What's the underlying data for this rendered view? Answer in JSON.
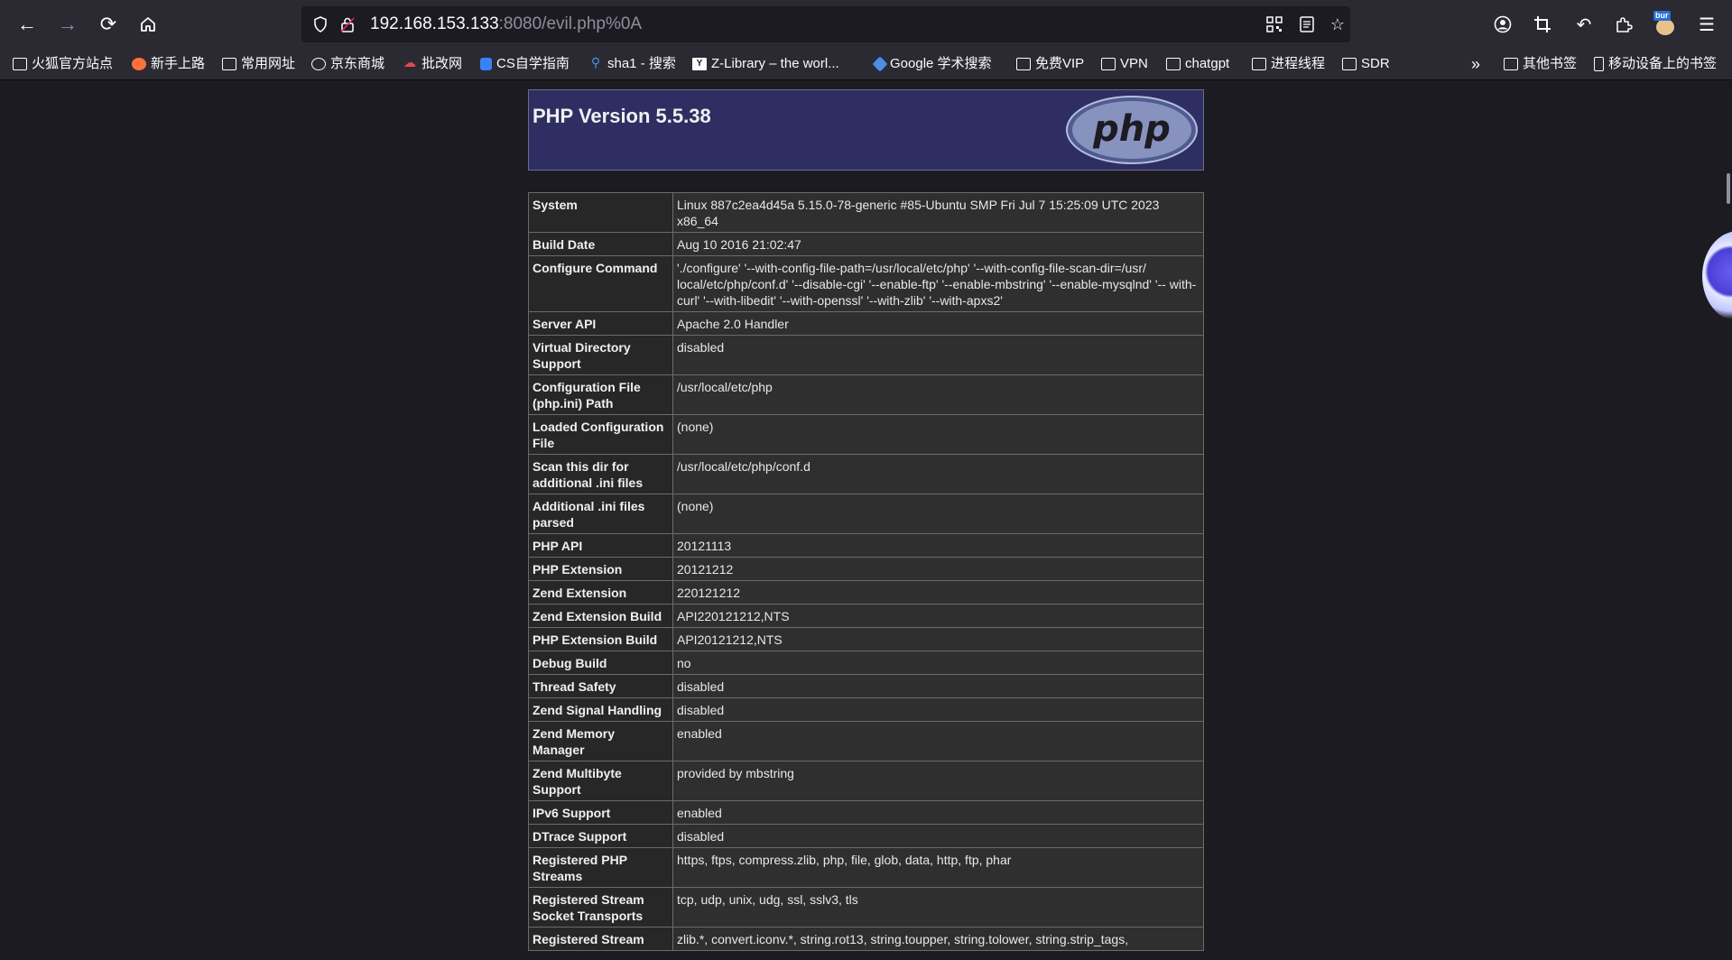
{
  "browser": {
    "url_host": "192.168.153.133",
    "url_path": ":8080/evil.php%0A",
    "profile_badge": "bur",
    "colors": {
      "chrome": "#2b2a33",
      "page": "#1c1b22",
      "header_bg": "#2e2e63"
    },
    "nav_icons": [
      "back-icon",
      "forward-icon",
      "reload-icon",
      "home-icon"
    ],
    "bookmarks": [
      {
        "label": "火狐官方站点",
        "icon": "folder-icon"
      },
      {
        "label": "新手上路",
        "icon": "firefox-icon"
      },
      {
        "label": "常用网址",
        "icon": "folder-icon"
      },
      {
        "label": "京东商城",
        "icon": "globe-icon"
      },
      {
        "label": "批改网",
        "icon": "cloud-icon"
      },
      {
        "label": "CS自学指南",
        "icon": "cube-icon"
      },
      {
        "label": "sha1 - 搜索",
        "icon": "search-icon"
      },
      {
        "label": "Z-Library – the worl...",
        "icon": "zlib-icon"
      },
      {
        "label": "Google 学术搜索",
        "icon": "scholar-icon"
      },
      {
        "label": "免费VIP",
        "icon": "folder-icon"
      },
      {
        "label": "VPN",
        "icon": "folder-icon"
      },
      {
        "label": "chatgpt",
        "icon": "folder-icon"
      },
      {
        "label": "进程线程",
        "icon": "folder-icon"
      },
      {
        "label": "SDR",
        "icon": "folder-icon"
      }
    ],
    "bookmarks_right": [
      {
        "label": "其他书签",
        "icon": "folder-icon"
      },
      {
        "label": "移动设备上的书签",
        "icon": "mobile-icon"
      }
    ]
  },
  "php": {
    "title": "PHP Version 5.5.38",
    "logo_text": "php",
    "rows": [
      {
        "key": "System",
        "value": "Linux 887c2ea4d45a 5.15.0-78-generic #85-Ubuntu SMP Fri Jul 7 15:25:09 UTC 2023 x86_64"
      },
      {
        "key": "Build Date",
        "value": "Aug 10 2016 21:02:47"
      },
      {
        "key": "Configure Command",
        "value": "'./configure' '--with-config-file-path=/usr/local/etc/php' '--with-config-file-scan-dir=/usr/ local/etc/php/conf.d' '--disable-cgi' '--enable-ftp' '--enable-mbstring' '--enable-mysqlnd' '-- with-curl' '--with-libedit' '--with-openssl' '--with-zlib' '--with-apxs2'"
      },
      {
        "key": "Server API",
        "value": "Apache 2.0 Handler"
      },
      {
        "key": "Virtual Directory Support",
        "value": "disabled"
      },
      {
        "key": "Configuration File (php.ini) Path",
        "value": "/usr/local/etc/php"
      },
      {
        "key": "Loaded Configuration File",
        "value": "(none)"
      },
      {
        "key": "Scan this dir for additional .ini files",
        "value": "/usr/local/etc/php/conf.d"
      },
      {
        "key": "Additional .ini files parsed",
        "value": "(none)"
      },
      {
        "key": "PHP API",
        "value": "20121113"
      },
      {
        "key": "PHP Extension",
        "value": "20121212"
      },
      {
        "key": "Zend Extension",
        "value": "220121212"
      },
      {
        "key": "Zend Extension Build",
        "value": "API220121212,NTS"
      },
      {
        "key": "PHP Extension Build",
        "value": "API20121212,NTS"
      },
      {
        "key": "Debug Build",
        "value": "no"
      },
      {
        "key": "Thread Safety",
        "value": "disabled"
      },
      {
        "key": "Zend Signal Handling",
        "value": "disabled"
      },
      {
        "key": "Zend Memory Manager",
        "value": "enabled"
      },
      {
        "key": "Zend Multibyte Support",
        "value": "provided by mbstring"
      },
      {
        "key": "IPv6 Support",
        "value": "enabled"
      },
      {
        "key": "DTrace Support",
        "value": "disabled"
      },
      {
        "key": "Registered PHP Streams",
        "value": "https, ftps, compress.zlib, php, file, glob, data, http, ftp, phar"
      },
      {
        "key": "Registered Stream Socket Transports",
        "value": "tcp, udp, unix, udg, ssl, sslv3, tls"
      },
      {
        "key": "Registered Stream",
        "value": "zlib.*, convert.iconv.*, string.rot13, string.toupper, string.tolower, string.strip_tags,"
      }
    ]
  }
}
